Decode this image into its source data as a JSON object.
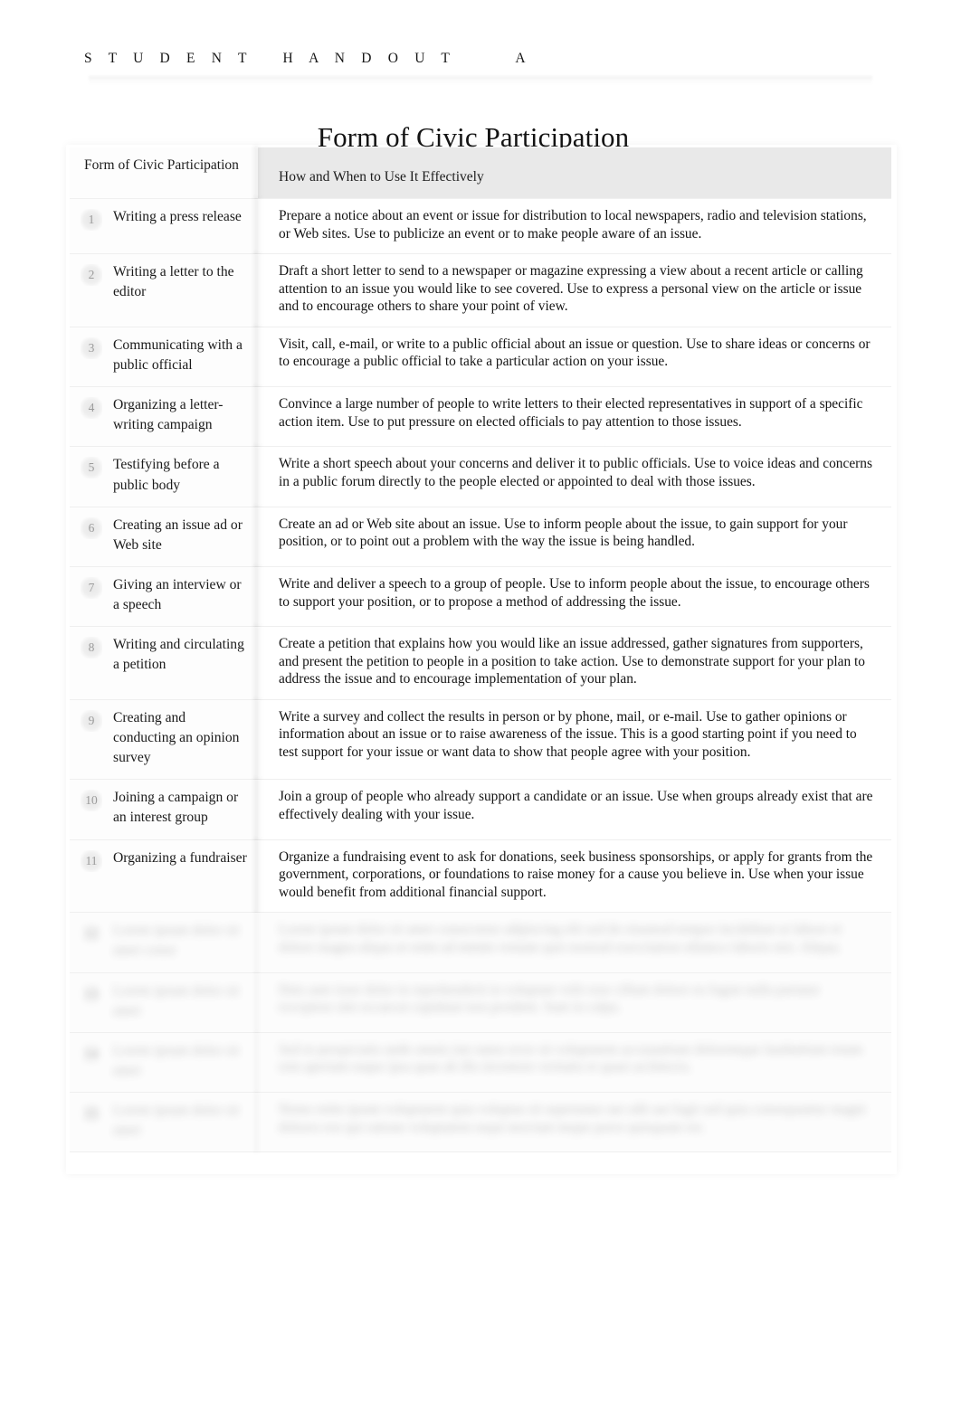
{
  "running_head": "S T U D E N T   H A N D O U T      A",
  "title": "Form of Civic Participation",
  "table": {
    "headers": {
      "col1": "Form of Civic Participation",
      "col2": "How and When to Use It Effectively"
    },
    "rows": [
      {
        "num": "1",
        "form": "Writing a press release",
        "description": "Prepare a notice about an event or issue for distribution to local newspapers, radio and television stations, or Web sites. Use to publicize an event or to make people aware of an issue.",
        "blurred": false
      },
      {
        "num": "2",
        "form": "Writing a letter to the editor",
        "description": "Draft a short letter to send to a newspaper or magazine expressing a view about a recent article or calling attention to an issue you would like to see covered. Use to express a personal view on the article or issue and to encourage others to share your point of view.",
        "blurred": false
      },
      {
        "num": "3",
        "form": "Communicating with a public official",
        "description": "Visit, call, e-mail, or write to a public official about an issue or question. Use to share ideas or concerns or to encourage a public official to take a particular action on your issue.",
        "blurred": false
      },
      {
        "num": "4",
        "form": "Organizing a letter-writing campaign",
        "description": "Convince a large number of people to write letters to their elected representatives in support of a specific action item. Use to put pressure on elected officials to pay attention to those issues.",
        "blurred": false
      },
      {
        "num": "5",
        "form": "Testifying before a public body",
        "description": "Write a short speech about your concerns and deliver it to public officials. Use to voice ideas and concerns in a public forum directly to the people elected or appointed to deal with those issues.",
        "blurred": false
      },
      {
        "num": "6",
        "form": "Creating an issue ad or Web site",
        "description": "Create an ad or Web site about an issue. Use to inform people about the issue, to gain support for your position, or to point out a problem with the way the issue is being handled.",
        "blurred": false
      },
      {
        "num": "7",
        "form": "Giving an interview or a speech",
        "description": "Write and deliver a speech to a group of people. Use to inform people about the issue, to encourage others to support your position, or to propose a method of addressing the issue.",
        "blurred": false
      },
      {
        "num": "8",
        "form": "Writing and circulating a petition",
        "description": "Create a petition that explains how you would like an issue addressed, gather signatures from supporters, and present the petition to people in a position to take action. Use to demonstrate support for your plan to address the issue and to encourage implementation of your plan.",
        "blurred": false
      },
      {
        "num": "9",
        "form": "Creating and conducting an opinion survey",
        "description": "Write a survey and collect the results in person or by phone, mail, or e-mail. Use to gather opinions or information about an issue or to raise awareness of the issue. This is a good starting point if you need to test support for your issue or want data to show that people agree with your position.",
        "blurred": false
      },
      {
        "num": "10",
        "form": "Joining a campaign or an interest group",
        "description": "Join a group of people who already support a candidate or an issue. Use when groups already exist that are effectively dealing with your issue.",
        "blurred": false
      },
      {
        "num": "11",
        "form": "Organizing a fundraiser",
        "description": "Organize a fundraising event to ask for donations, seek business sponsorships, or apply for grants from the government, corporations, or foundations to raise money for a cause you believe in. Use when your issue would benefit from additional financial support.",
        "blurred": false
      },
      {
        "num": "12",
        "form": "Lorem ipsum dolor sit amet conse",
        "description": "Lorem ipsum dolor sit amet consectetur adipiscing elit sed do eiusmod tempor incididunt ut labore et dolore magna aliqua ut enim ad minim veniam quis nostrud exercitation ullamco laboris nisi. Aliqua.",
        "blurred": true
      },
      {
        "num": "13",
        "form": "Lorem ipsum dolor sit amet",
        "description": "Duis aute irure dolor in reprehenderit in voluptate velit esse cillum dolore eu fugiat nulla pariatur excepteur sint occaecat cupidatat non proident. Sunt in culpa.",
        "blurred": true
      },
      {
        "num": "14",
        "form": "Lorem ipsum dolor sit amet",
        "description": "Sed ut perspiciatis unde omnis iste natus error sit voluptatem accusantium doloremque laudantium totam rem aperiam eaque ipsa quae ab illo inventore veritatis et quasi architecto.",
        "blurred": true
      },
      {
        "num": "15",
        "form": "Lorem ipsum dolor sit amet",
        "description": "Nemo enim ipsam voluptatem quia voluptas sit aspernatur aut odit aut fugit sed quia consequuntur magni dolores eos qui ratione voluptatem sequi nesciunt neque porro quisquam est.",
        "blurred": true
      }
    ]
  }
}
